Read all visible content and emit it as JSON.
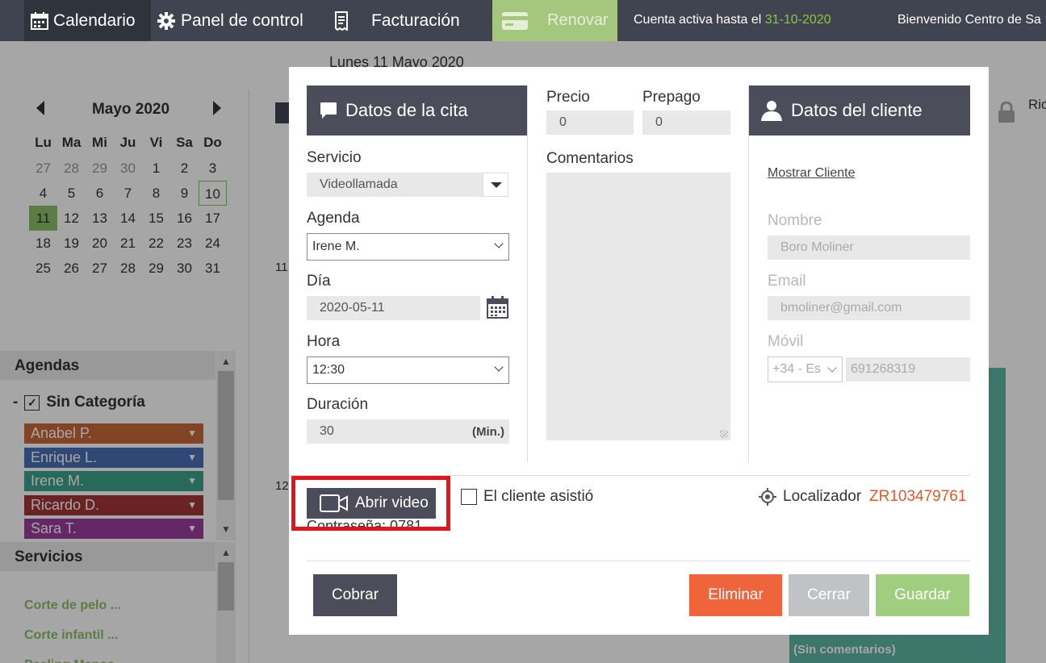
{
  "topbar": {
    "calendar_label": "Calendario",
    "panel_label": "Panel de control",
    "billing_label": "Facturación",
    "renew_label": "Renovar",
    "account_prefix": "Cuenta activa hasta el",
    "account_date": "31-10-2020",
    "welcome": "Bienvenido Centro de Sa"
  },
  "mini_calendar": {
    "title": "Mayo 2020",
    "day_headers": [
      "Lu",
      "Ma",
      "Mi",
      "Ju",
      "Vi",
      "Sa",
      "Do"
    ],
    "days": [
      {
        "n": "27",
        "other": true
      },
      {
        "n": "28",
        "other": true
      },
      {
        "n": "29",
        "other": true
      },
      {
        "n": "30",
        "other": true
      },
      {
        "n": "1"
      },
      {
        "n": "2"
      },
      {
        "n": "3"
      },
      {
        "n": "4"
      },
      {
        "n": "5"
      },
      {
        "n": "6"
      },
      {
        "n": "7"
      },
      {
        "n": "8"
      },
      {
        "n": "9"
      },
      {
        "n": "10",
        "selected": true
      },
      {
        "n": "11",
        "today": true
      },
      {
        "n": "12"
      },
      {
        "n": "13"
      },
      {
        "n": "14"
      },
      {
        "n": "15"
      },
      {
        "n": "16"
      },
      {
        "n": "17"
      },
      {
        "n": "18"
      },
      {
        "n": "19"
      },
      {
        "n": "20"
      },
      {
        "n": "21"
      },
      {
        "n": "22"
      },
      {
        "n": "23"
      },
      {
        "n": "24"
      },
      {
        "n": "25"
      },
      {
        "n": "26"
      },
      {
        "n": "27"
      },
      {
        "n": "28"
      },
      {
        "n": "29"
      },
      {
        "n": "30"
      },
      {
        "n": "31"
      }
    ]
  },
  "sidebar": {
    "agendas_title": "Agendas",
    "category_dash": "-",
    "category_label": "Sin Categoría",
    "agendas": [
      {
        "label": "Anabel P.",
        "color": "#c8693a"
      },
      {
        "label": "Enrique L.",
        "color": "#4a6fb5"
      },
      {
        "label": "Irene M.",
        "color": "#3da48c"
      },
      {
        "label": "Ricardo D.",
        "color": "#a33636"
      },
      {
        "label": "Sara T.",
        "color": "#9b3c9c"
      }
    ],
    "services_title": "Servicios",
    "services": [
      "Corte de pelo ...",
      "Corte infantil ...",
      "Peeling Manos ..."
    ]
  },
  "calendar_main": {
    "date_label": "Lunes 11 Mayo 2020",
    "hour_11": "11",
    "hour_12": "12",
    "column_label": "Ric",
    "event_text": "(Sin comentarios)"
  },
  "modal": {
    "appointment_header": "Datos de la cita",
    "service_label": "Servicio",
    "service_value": "Videollamada",
    "agenda_label": "Agenda",
    "agenda_value": "Irene M.",
    "day_label": "Día",
    "day_value": "2020-05-11",
    "time_label": "Hora",
    "time_value": "12:30",
    "duration_label": "Duración",
    "duration_value": "30",
    "duration_unit": "(Min.)",
    "price_label": "Precio",
    "price_value": "0",
    "prepay_label": "Prepago",
    "prepay_value": "0",
    "comments_label": "Comentarios",
    "client_header": "Datos del cliente",
    "show_client": "Mostrar Cliente",
    "name_label": "Nombre",
    "name_value": "Boro Moliner",
    "email_label": "Email",
    "email_value": "bmoliner@gmail.com",
    "mobile_label": "Móvil",
    "country_code": "+34 - Es",
    "mobile_value": "691268319",
    "open_video": "Abrir video",
    "password_text": "Contraseña: 0781",
    "attended_label": "El cliente asistió",
    "locator_label": "Localizador",
    "locator_value": "ZR103479761",
    "charge_button": "Cobrar",
    "delete_button": "Eliminar",
    "close_button": "Cerrar",
    "save_button": "Guardar"
  },
  "colors": {
    "accent_green": "#8cc06b",
    "locator_orange": "#e5582a",
    "delete": "#f0643c",
    "close": "#c0c3c6",
    "save": "#9fcf7e",
    "dark": "#4b4e5a"
  }
}
